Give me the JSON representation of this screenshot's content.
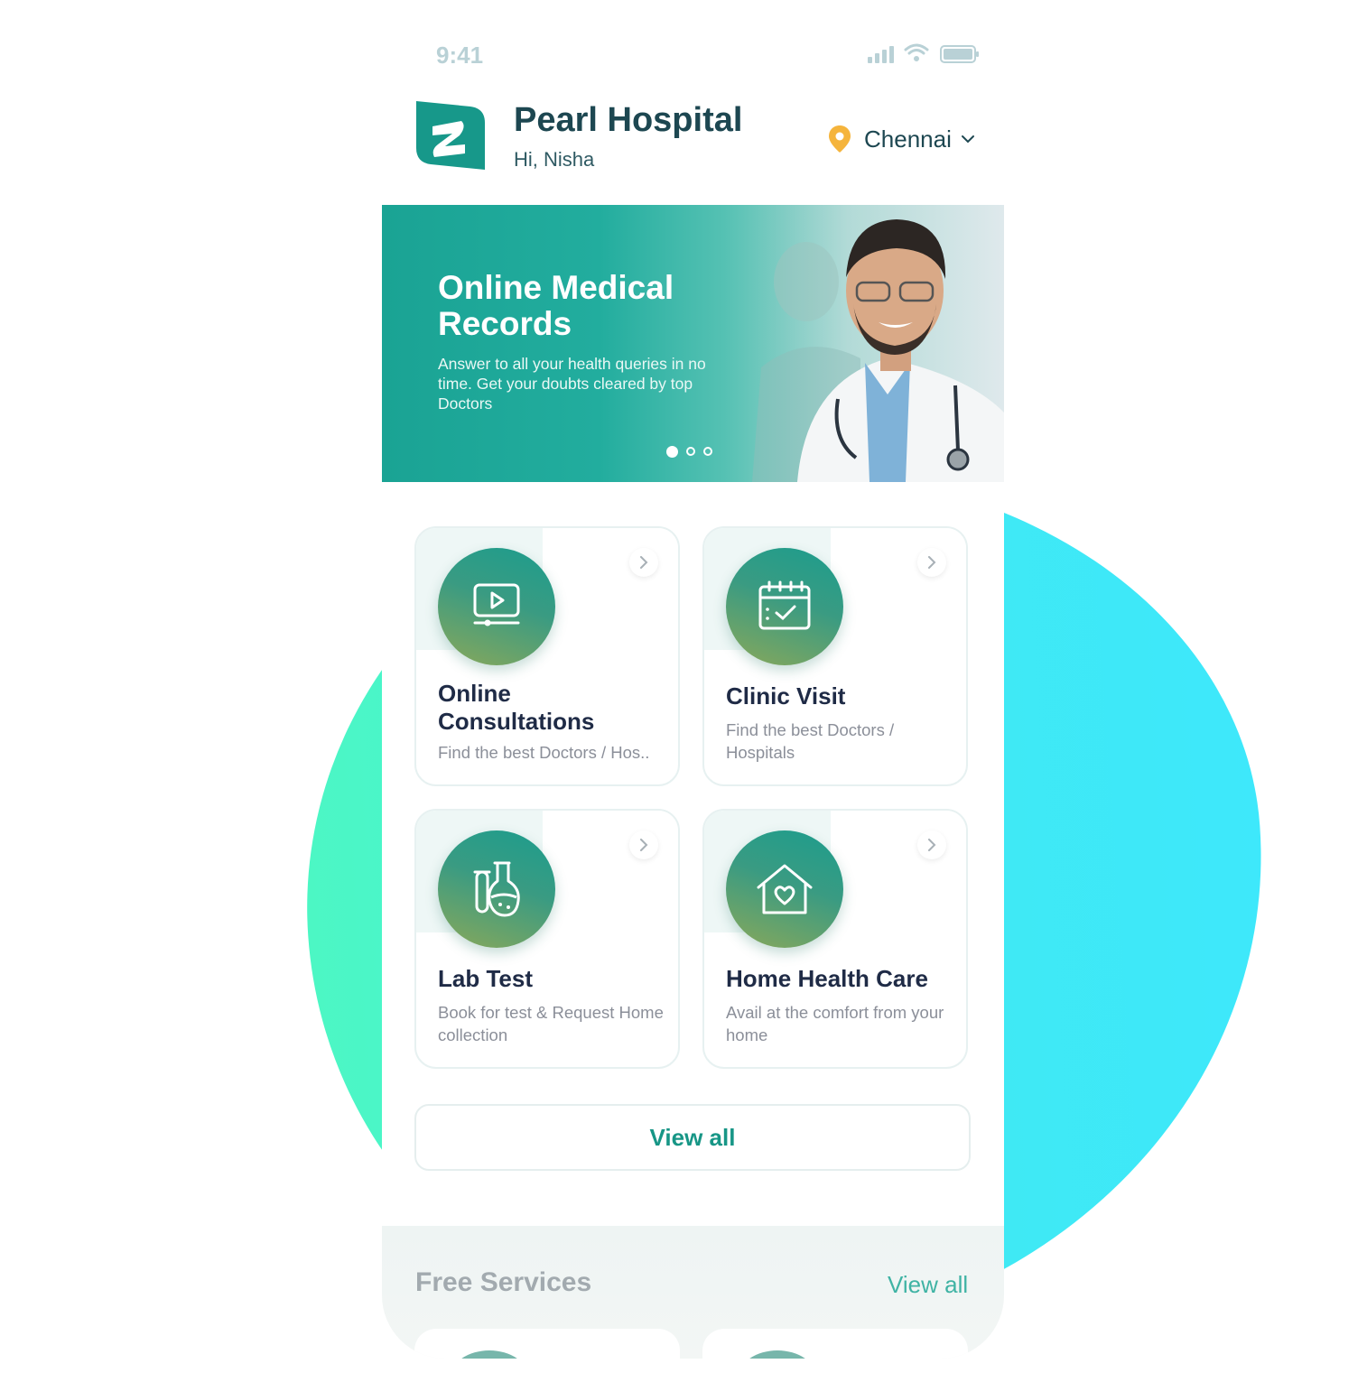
{
  "status_bar": {
    "time": "9:41"
  },
  "header": {
    "app_name": "Pearl Hospital",
    "greeting": "Hi, Nisha",
    "location": "Chennai"
  },
  "banner": {
    "title": "Online Medical Records",
    "description": "Answer to all your health queries in no time. Get your doubts cleared by top Doctors",
    "slides": 3,
    "active_slide": 1
  },
  "services": [
    {
      "title": "Online Consultations",
      "description": "Find the best Doctors / Hos..",
      "icon": "video-consult-icon"
    },
    {
      "title": "Clinic Visit",
      "description": "Find the best Doctors / Hospitals",
      "icon": "calendar-check-icon"
    },
    {
      "title": "Lab Test",
      "description": "Book for test & Request Home collection",
      "icon": "lab-flask-icon"
    },
    {
      "title": "Home Health Care",
      "description": "Avail at the comfort from your home",
      "icon": "home-heart-icon"
    }
  ],
  "view_all_label": "View all",
  "free_services": {
    "title": "Free Services",
    "link": "View all"
  },
  "colors": {
    "brand": "#179686",
    "title_dark": "#1d4751",
    "pin": "#f5b43c"
  }
}
